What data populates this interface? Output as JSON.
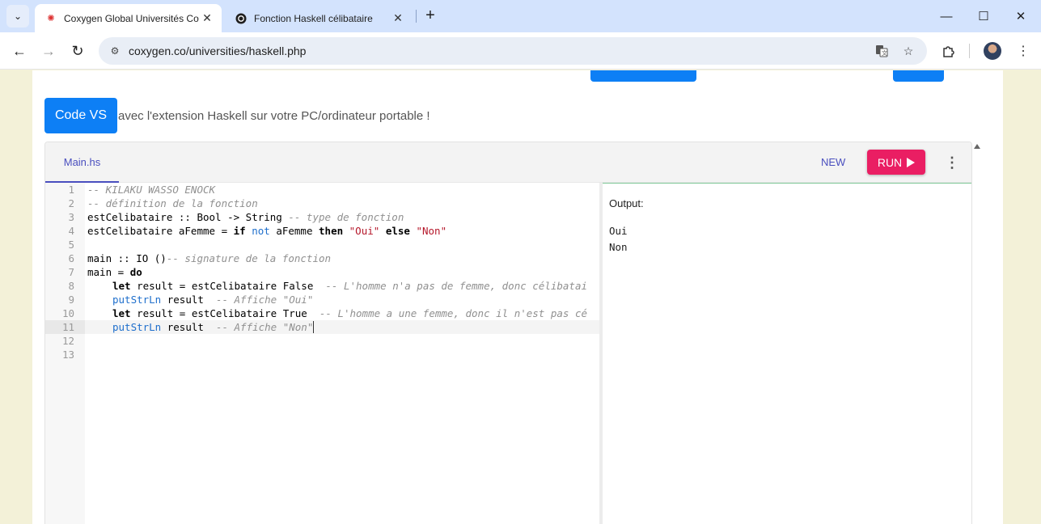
{
  "browser": {
    "tabs": [
      {
        "title": "Coxygen Global Universités Coll",
        "active": true
      },
      {
        "title": "Fonction Haskell célibataire",
        "active": false
      }
    ],
    "url": "coxygen.co/universities/haskell.php"
  },
  "page": {
    "codevs_label": "Code VS",
    "intro_text": "avec l'extension Haskell sur votre PC/ordinateur portable !"
  },
  "editor": {
    "file_tab": "Main.hs",
    "new_label": "NEW",
    "run_label": "RUN",
    "line_numbers": [
      "1",
      "2",
      "3",
      "4",
      "5",
      "6",
      "7",
      "8",
      "9",
      "10",
      "11",
      "12",
      "13"
    ],
    "code": {
      "l1": "-- KILAKU WASSO ENOCK",
      "l2": "-- définition de la fonction",
      "l3a": "estCelibataire :: Bool -> String ",
      "l3b": "-- type de fonction",
      "l4a": "estCelibataire aFemme = ",
      "l4if": "if",
      "l4not": "not",
      "l4b": " aFemme ",
      "l4then": "then",
      "l4oui": "\"Oui\"",
      "l4else": "else",
      "l4non": "\"Non\"",
      "l6a": "main :: IO ()",
      "l6b": "-- signature de la fonction",
      "l7a": "main = ",
      "l7do": "do",
      "l8a": "let",
      "l8b": " result = estCelibataire False  ",
      "l8c": "-- L'homme n'a pas de femme, donc célibatai",
      "l9a": "putStrLn",
      "l9b": " result  ",
      "l9c": "-- Affiche \"Oui\"",
      "l10a": "let",
      "l10b": " result = estCelibataire True  ",
      "l10c": "-- L'homme a une femme, donc il n'est pas cé",
      "l11a": "putStrLn",
      "l11b": " result  ",
      "l11c": "-- Affiche \"Non\""
    }
  },
  "output": {
    "label": "Output:",
    "lines": [
      "Oui",
      "Non"
    ]
  }
}
